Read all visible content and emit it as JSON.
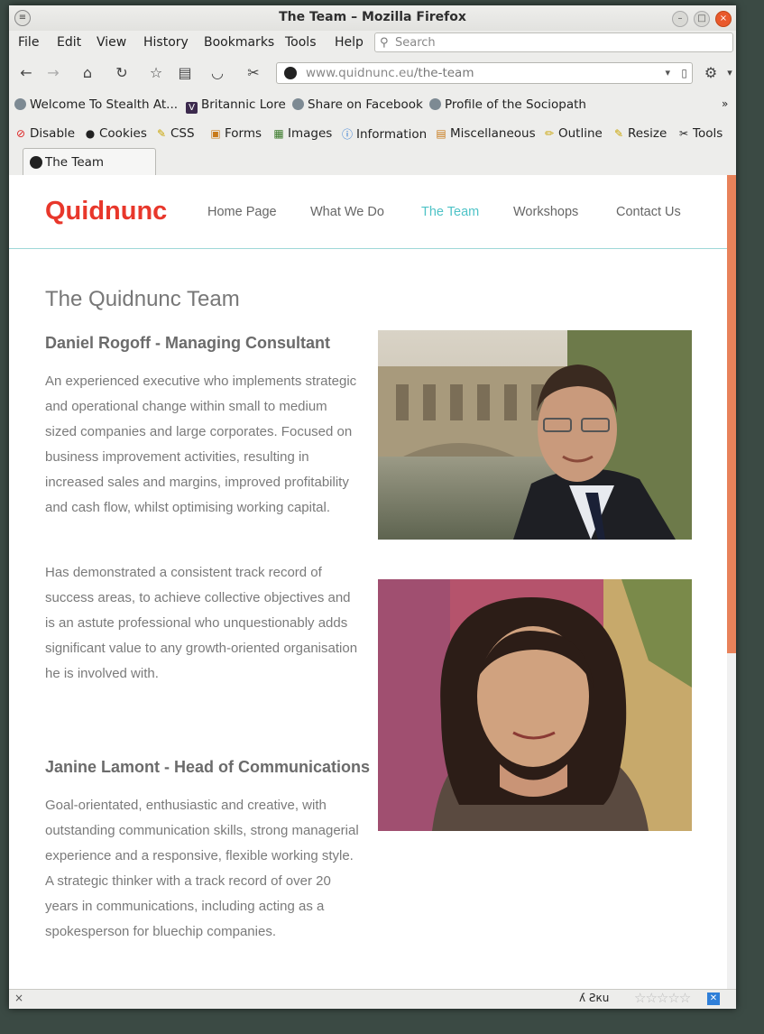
{
  "window": {
    "title": "The Team – Mozilla Firefox"
  },
  "menu": {
    "file": "File",
    "edit": "Edit",
    "view": "View",
    "history": "History",
    "bookmarks": "Bookmarks",
    "tools": "Tools",
    "help": "Help"
  },
  "search": {
    "placeholder": "Search"
  },
  "urlbar": {
    "domain": "www.quidnunc.eu",
    "path": "/the-team"
  },
  "bookmarks": [
    {
      "label": "Welcome To Stealth At..."
    },
    {
      "label": "Britannic Lore"
    },
    {
      "label": "Share on Facebook"
    },
    {
      "label": "Profile of the Sociopath"
    }
  ],
  "webdev": [
    {
      "label": "Disable",
      "icon": "⊘"
    },
    {
      "label": "Cookies",
      "icon": "●"
    },
    {
      "label": "CSS",
      "icon": "✎"
    },
    {
      "label": "Forms",
      "icon": "▣"
    },
    {
      "label": "Images",
      "icon": "▦"
    },
    {
      "label": "Information",
      "icon": "ⓘ"
    },
    {
      "label": "Miscellaneous",
      "icon": "▤"
    },
    {
      "label": "Outline",
      "icon": "✏"
    },
    {
      "label": "Resize",
      "icon": "✎"
    },
    {
      "label": "Tools",
      "icon": "✂"
    }
  ],
  "tab": {
    "label": "The Team"
  },
  "site": {
    "logo": "Quidnunc",
    "nav": [
      "Home Page",
      "What We Do",
      "The Team",
      "Workshops",
      "Contact Us"
    ],
    "active_color": "#4fc3c7",
    "brand_color": "#e8372b"
  },
  "page": {
    "title": "The Quidnunc Team",
    "people": [
      {
        "name": "Daniel Rogoff - Managing Consultant",
        "paragraphs": [
          "An experienced executive who implements strategic and operational change within small to medium sized companies and large corporates. Focused on business improvement activities, resulting in increased sales and margins, improved profitability and cash flow, whilst optimising working capital.",
          "Has demonstrated a consistent track record of success areas, to achieve collective objectives and is an astute professional who unquestionably adds significant value to any growth-oriented organisation he is involved with."
        ]
      },
      {
        "name": "Janine Lamont - Head of Communications",
        "paragraphs": [
          "Goal-orientated, enthusiastic and creative, with outstanding communication skills, strong managerial experience and a responsive, flexible working style.  A strategic thinker with a track record of over 20 years in communications, including acting as a spokesperson for bluechip companies."
        ]
      }
    ]
  },
  "statusbar": {
    "close": "×",
    "translate": "ʎ Ƨкu",
    "rating": "☆☆☆☆☆"
  }
}
